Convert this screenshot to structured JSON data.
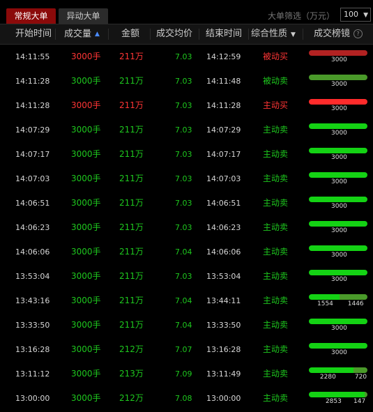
{
  "tabs": [
    {
      "label": "常规大单",
      "active": true
    },
    {
      "label": "异动大单",
      "active": false
    }
  ],
  "filter": {
    "label": "大单筛选（万元）",
    "value": "100"
  },
  "columns": [
    "开始时间",
    "成交量",
    "金额",
    "成交均价",
    "结束时间",
    "综合性质",
    "成交榜镜"
  ],
  "colors": {
    "buy": "#ff3535",
    "sell": "#1ec81e",
    "passive_buy": "#b22222",
    "passive_sell": "#4a9a2a"
  },
  "rows": [
    {
      "start": "14:11:55",
      "volume": "3000手",
      "amount": "211万",
      "avg": "7.03",
      "end": "14:12:59",
      "nature": "被动买",
      "vol_color": "red",
      "nature_color": "red",
      "bar": [
        {
          "v": "3000",
          "pct": 100,
          "color": "#b22222"
        }
      ]
    },
    {
      "start": "14:11:28",
      "volume": "3000手",
      "amount": "211万",
      "avg": "7.03",
      "end": "14:11:48",
      "nature": "被动卖",
      "vol_color": "green",
      "nature_color": "green",
      "bar": [
        {
          "v": "3000",
          "pct": 100,
          "color": "#4a9a2a"
        }
      ]
    },
    {
      "start": "14:11:28",
      "volume": "3000手",
      "amount": "211万",
      "avg": "7.03",
      "end": "14:11:28",
      "nature": "主动买",
      "vol_color": "red",
      "nature_color": "red",
      "bar": [
        {
          "v": "3000",
          "pct": 100,
          "color": "#ff2b2b"
        }
      ]
    },
    {
      "start": "14:07:29",
      "volume": "3000手",
      "amount": "211万",
      "avg": "7.03",
      "end": "14:07:29",
      "nature": "主动卖",
      "vol_color": "green",
      "nature_color": "green",
      "bar": [
        {
          "v": "3000",
          "pct": 100,
          "color": "#14d214"
        }
      ]
    },
    {
      "start": "14:07:17",
      "volume": "3000手",
      "amount": "211万",
      "avg": "7.03",
      "end": "14:07:17",
      "nature": "主动卖",
      "vol_color": "green",
      "nature_color": "green",
      "bar": [
        {
          "v": "3000",
          "pct": 100,
          "color": "#14d214"
        }
      ]
    },
    {
      "start": "14:07:03",
      "volume": "3000手",
      "amount": "211万",
      "avg": "7.03",
      "end": "14:07:03",
      "nature": "主动卖",
      "vol_color": "green",
      "nature_color": "green",
      "bar": [
        {
          "v": "3000",
          "pct": 100,
          "color": "#14d214"
        }
      ]
    },
    {
      "start": "14:06:51",
      "volume": "3000手",
      "amount": "211万",
      "avg": "7.03",
      "end": "14:06:51",
      "nature": "主动卖",
      "vol_color": "green",
      "nature_color": "green",
      "bar": [
        {
          "v": "3000",
          "pct": 100,
          "color": "#14d214"
        }
      ]
    },
    {
      "start": "14:06:23",
      "volume": "3000手",
      "amount": "211万",
      "avg": "7.03",
      "end": "14:06:23",
      "nature": "主动卖",
      "vol_color": "green",
      "nature_color": "green",
      "bar": [
        {
          "v": "3000",
          "pct": 100,
          "color": "#14d214"
        }
      ]
    },
    {
      "start": "14:06:06",
      "volume": "3000手",
      "amount": "211万",
      "avg": "7.04",
      "end": "14:06:06",
      "nature": "主动卖",
      "vol_color": "green",
      "nature_color": "green",
      "bar": [
        {
          "v": "3000",
          "pct": 100,
          "color": "#14d214"
        }
      ]
    },
    {
      "start": "13:53:04",
      "volume": "3000手",
      "amount": "211万",
      "avg": "7.03",
      "end": "13:53:04",
      "nature": "主动卖",
      "vol_color": "green",
      "nature_color": "green",
      "bar": [
        {
          "v": "3000",
          "pct": 100,
          "color": "#14d214"
        }
      ]
    },
    {
      "start": "13:43:16",
      "volume": "3000手",
      "amount": "211万",
      "avg": "7.04",
      "end": "13:44:11",
      "nature": "主动卖",
      "vol_color": "green",
      "nature_color": "green",
      "bar": [
        {
          "v": "1554",
          "pct": 51.8,
          "color": "#14d214"
        },
        {
          "v": "1446",
          "pct": 48.2,
          "color": "#4a9a2a"
        }
      ]
    },
    {
      "start": "13:33:50",
      "volume": "3000手",
      "amount": "211万",
      "avg": "7.04",
      "end": "13:33:50",
      "nature": "主动卖",
      "vol_color": "green",
      "nature_color": "green",
      "bar": [
        {
          "v": "3000",
          "pct": 100,
          "color": "#14d214"
        }
      ]
    },
    {
      "start": "13:16:28",
      "volume": "3000手",
      "amount": "212万",
      "avg": "7.07",
      "end": "13:16:28",
      "nature": "主动卖",
      "vol_color": "green",
      "nature_color": "green",
      "bar": [
        {
          "v": "3000",
          "pct": 100,
          "color": "#14d214"
        }
      ]
    },
    {
      "start": "13:11:12",
      "volume": "3000手",
      "amount": "213万",
      "avg": "7.09",
      "end": "13:11:49",
      "nature": "主动卖",
      "vol_color": "green",
      "nature_color": "green",
      "bar": [
        {
          "v": "2280",
          "pct": 76,
          "color": "#14d214"
        },
        {
          "v": "720",
          "pct": 24,
          "color": "#4a9a2a"
        }
      ]
    },
    {
      "start": "13:00:00",
      "volume": "3000手",
      "amount": "212万",
      "avg": "7.08",
      "end": "13:00:00",
      "nature": "主动卖",
      "vol_color": "green",
      "nature_color": "green",
      "bar": [
        {
          "v": "2853",
          "pct": 95.1,
          "color": "#14d214"
        },
        {
          "v": "147",
          "pct": 4.9,
          "color": "#4a9a2a"
        }
      ]
    }
  ]
}
